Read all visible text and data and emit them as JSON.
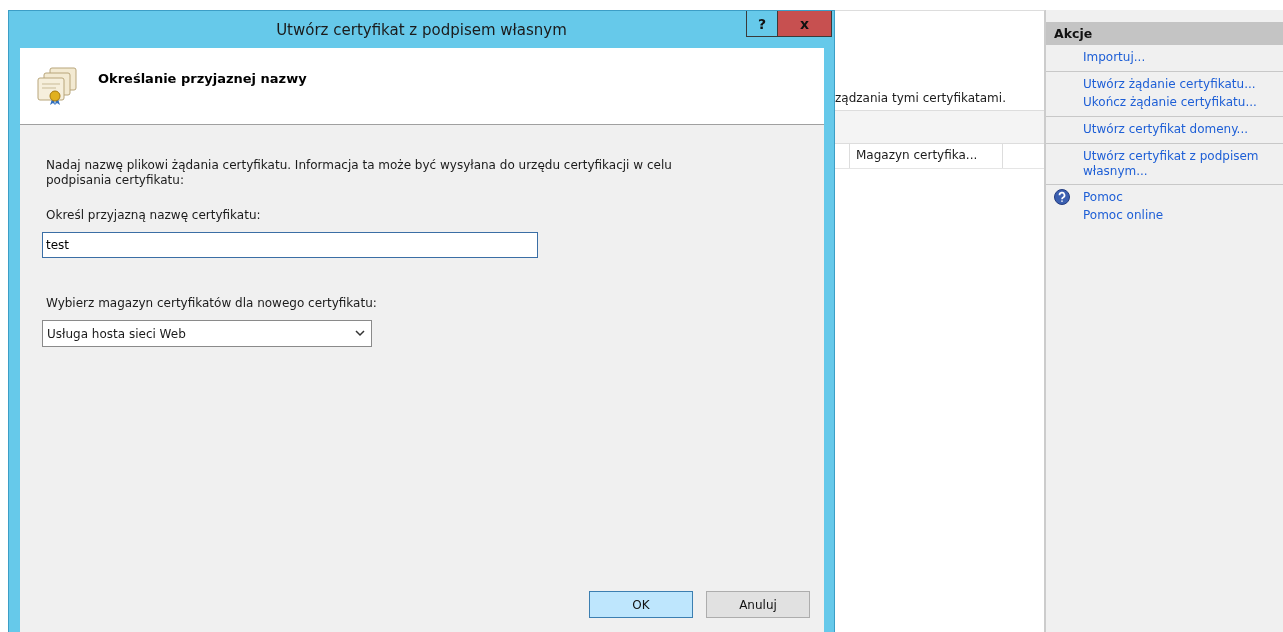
{
  "dialog": {
    "title": "Utwórz certyfikat z podpisem własnym",
    "help_button": "?",
    "close_button": "x",
    "header": {
      "title": "Określanie przyjaznej nazwy"
    },
    "description": "Nadaj nazwę plikowi żądania certyfikatu. Informacja ta może być wysyłana do urzędu certyfikacji w celu podpisania certyfikatu:",
    "name_label": "Określ przyjazną nazwę certyfikatu:",
    "name_value": "test",
    "store_label": "Wybierz magazyn certyfikatów dla nowego certyfikatu:",
    "store_select": "Usługa hosta sieci Web",
    "buttons": [
      {
        "label": "OK",
        "default": true
      },
      {
        "label": "Anuluj",
        "default": false
      }
    ]
  },
  "background": {
    "description_fragment": "ządzania tymi certyfikatami.",
    "column_header": "Magazyn certyfika..."
  },
  "actions_panel": {
    "title": "Akcje",
    "groups": [
      {
        "items": [
          {
            "label": "Importuj...",
            "kind": "link"
          }
        ]
      },
      {
        "items": [
          {
            "label": "Utwórz żądanie certyfikatu...",
            "kind": "link"
          },
          {
            "label": "Ukończ żądanie certyfikatu...",
            "kind": "link"
          }
        ]
      },
      {
        "items": [
          {
            "label": "Utwórz certyfikat domeny...",
            "kind": "link"
          }
        ]
      },
      {
        "items": [
          {
            "label": "Utwórz certyfikat z podpisem własnym...",
            "kind": "link"
          }
        ]
      },
      {
        "items": [
          {
            "label": "Pomoc",
            "kind": "help"
          },
          {
            "label": "Pomoc online",
            "kind": "link"
          }
        ]
      }
    ]
  }
}
